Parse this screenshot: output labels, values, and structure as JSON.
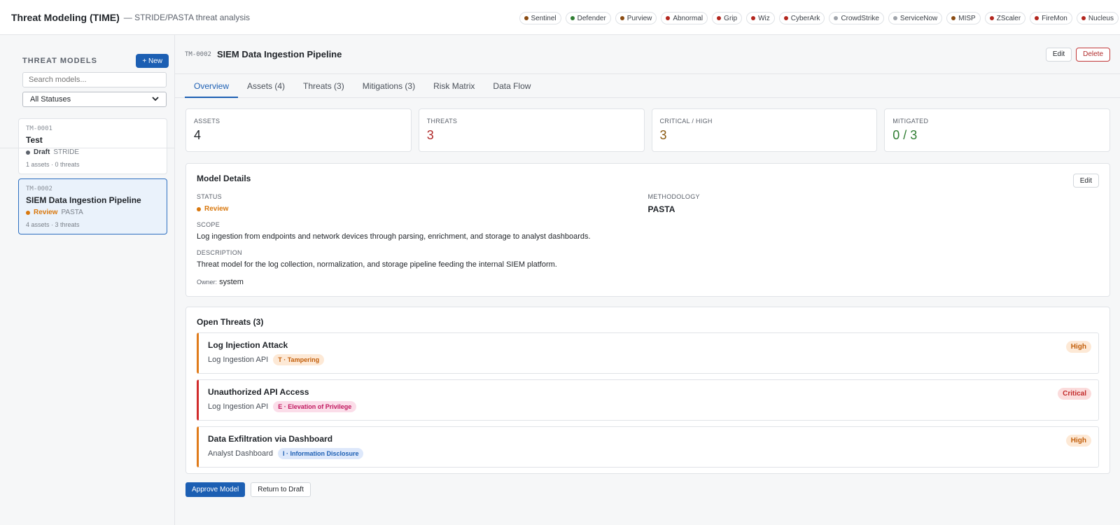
{
  "app": {
    "title": "Threat Modeling (TIME)",
    "subtitle": "— STRIDE/PASTA threat analysis"
  },
  "integrations": [
    {
      "label": "Sentinel",
      "color": "#8a4b12"
    },
    {
      "label": "Defender",
      "color": "#2f7d32"
    },
    {
      "label": "Purview",
      "color": "#8a4b12"
    },
    {
      "label": "Abnormal",
      "color": "#b3261e"
    },
    {
      "label": "Grip",
      "color": "#b3261e"
    },
    {
      "label": "Wiz",
      "color": "#b3261e"
    },
    {
      "label": "CyberArk",
      "color": "#b3261e"
    },
    {
      "label": "CrowdStrike",
      "color": "#a0a4ab"
    },
    {
      "label": "ServiceNow",
      "color": "#a0a4ab"
    },
    {
      "label": "MISP",
      "color": "#8a4b12"
    },
    {
      "label": "ZScaler",
      "color": "#b3261e"
    },
    {
      "label": "FireMon",
      "color": "#b3261e"
    },
    {
      "label": "Nucleus",
      "color": "#b3261e"
    }
  ],
  "sidebar": {
    "title": "THREAT MODELS",
    "new_label": "+ New",
    "search_placeholder": "Search models...",
    "status_filter": "All Statuses",
    "models": [
      {
        "id": "TM-0001",
        "name": "Test",
        "status": "Draft",
        "status_color": "#5b616b",
        "methodology": "STRIDE",
        "counts": "1 assets · 0 threats"
      },
      {
        "id": "TM-0002",
        "name": "SIEM Data Ingestion Pipeline",
        "status": "Review",
        "status_color": "#d9780e",
        "methodology": "PASTA",
        "counts": "4 assets · 3 threats"
      }
    ]
  },
  "main": {
    "id": "TM-0002",
    "title": "SIEM Data Ingestion Pipeline",
    "edit_label": "Edit",
    "delete_label": "Delete",
    "tabs": [
      "Overview",
      "Assets (4)",
      "Threats (3)",
      "Mitigations (3)",
      "Risk Matrix",
      "Data Flow"
    ],
    "stats": [
      {
        "label": "ASSETS",
        "value": "4",
        "color": "#1f2328"
      },
      {
        "label": "THREATS",
        "value": "3",
        "color": "#b02a2a"
      },
      {
        "label": "CRITICAL / HIGH",
        "value": "3",
        "color": "#8a5a12"
      },
      {
        "label": "MITIGATED",
        "value": "0 / 3",
        "color": "#2f7d32"
      }
    ],
    "details": {
      "title": "Model Details",
      "edit_label": "Edit",
      "status_label": "STATUS",
      "status_value": "Review",
      "methodology_label": "METHODOLOGY",
      "methodology_value": "PASTA",
      "scope_label": "SCOPE",
      "scope_value": "Log ingestion from endpoints and network devices through parsing, enrichment, and storage to analyst dashboards.",
      "description_label": "DESCRIPTION",
      "description_value": "Threat model for the log collection, normalization, and storage pipeline feeding the internal SIEM platform.",
      "owner_label": "Owner:",
      "owner_value": "system"
    },
    "threats": {
      "title": "Open Threats (3)",
      "items": [
        {
          "title": "Log Injection Attack",
          "asset": "Log Ingestion API",
          "tag": "T · Tampering",
          "tag_bg": "#fde9d6",
          "tag_fg": "#c25e0a",
          "severity": "High",
          "sev_bg": "#fde9d6",
          "sev_fg": "#c25e0a"
        },
        {
          "title": "Unauthorized API Access",
          "asset": "Log Ingestion API",
          "tag": "E · Elevation of Privilege",
          "tag_bg": "#fbdde9",
          "tag_fg": "#c0185f",
          "severity": "Critical",
          "sev_bg": "#fbdcdc",
          "sev_fg": "#c22a2a"
        },
        {
          "title": "Data Exfiltration via Dashboard",
          "asset": "Analyst Dashboard",
          "tag": "I · Information Disclosure",
          "tag_bg": "#dde8fb",
          "tag_fg": "#1c5fb3",
          "severity": "High",
          "sev_bg": "#fde9d6",
          "sev_fg": "#c25e0a"
        }
      ]
    },
    "approve_label": "Approve Model",
    "return_label": "Return to Draft"
  }
}
